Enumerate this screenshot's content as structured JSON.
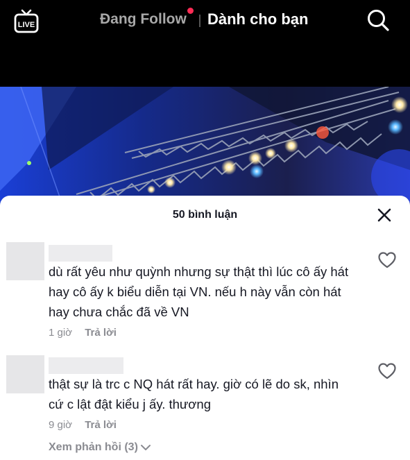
{
  "header": {
    "live_icon": "live-tv-icon",
    "live_label": "LIVE",
    "tab_following": "Đang Follow",
    "tab_for_you": "Dành cho bạn",
    "search_icon": "search-icon",
    "notification_dot_color": "#fe2c55"
  },
  "comments_panel": {
    "title": "50 bình luận",
    "close_icon": "close-icon",
    "comments": [
      {
        "text": "dù rất yêu như quỳnh nhưng sự thật thì lúc cô ấy hát hay cô ấy k biểu diễn tại VN. nếu h này vẫn còn hát hay chưa chắc đã về VN",
        "time": "1 giờ",
        "reply_label": "Trả lời",
        "like_icon": "heart-outline-icon"
      },
      {
        "text": "thật sự là trc c NQ hát rất hay. giờ có lẽ do sk, nhìn cứ c lật đật kiểu j ấy. thương",
        "time": "9 giờ",
        "reply_label": "Trả lời",
        "like_icon": "heart-outline-icon"
      }
    ],
    "view_replies_label": "Xem phản hồi (3)"
  }
}
